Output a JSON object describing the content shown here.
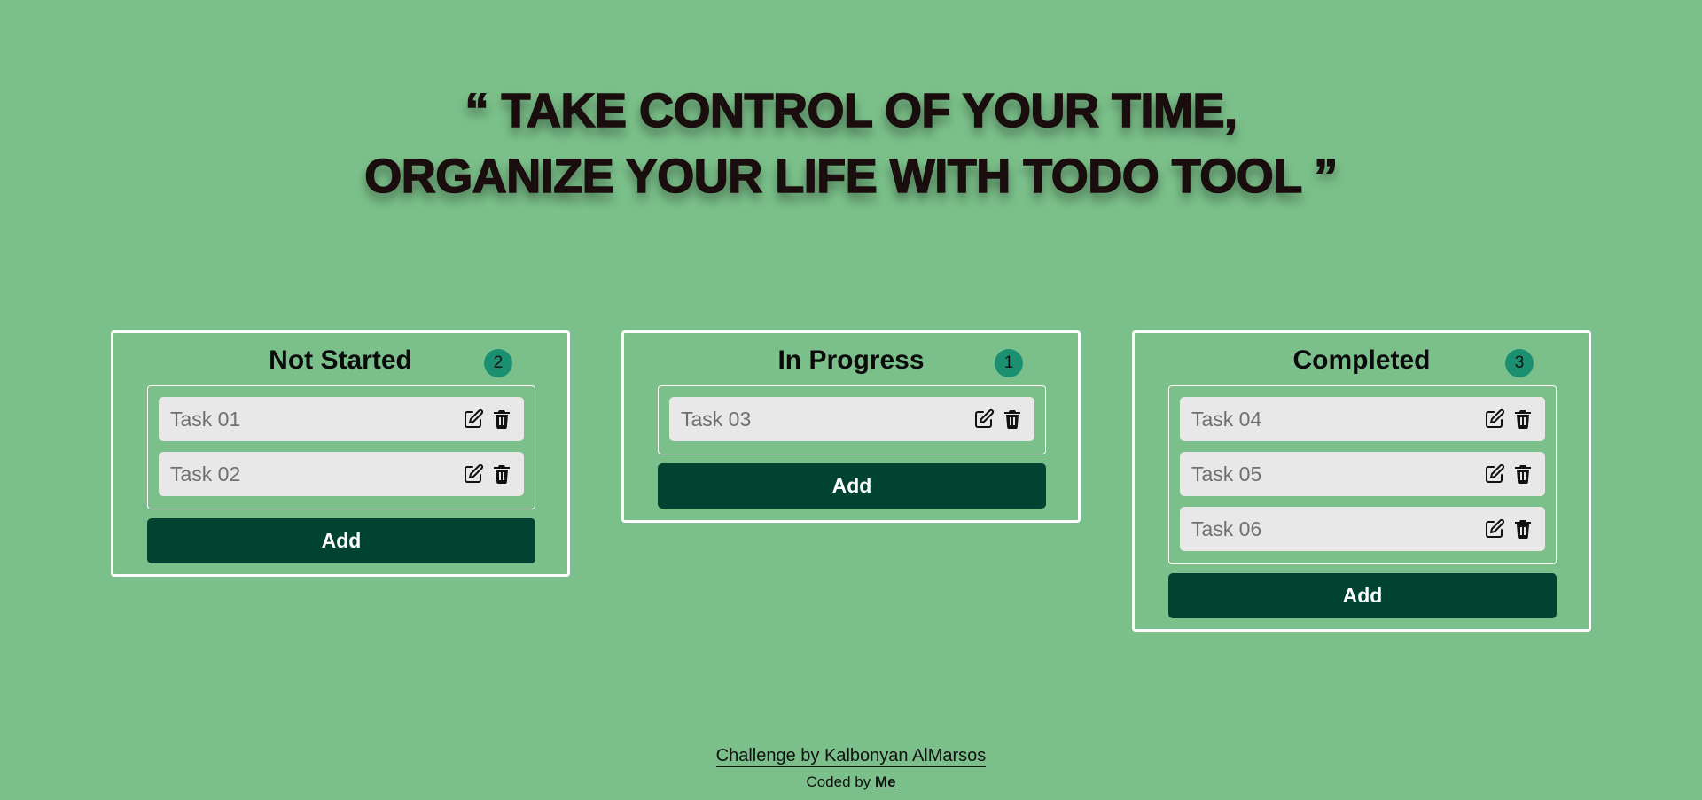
{
  "hero": {
    "line1": "“ TAKE CONTROL OF YOUR TIME,",
    "line2": "ORGANIZE YOUR LIFE WITH TODO TOOL ”"
  },
  "boards": [
    {
      "title": "Not Started",
      "count": "2",
      "tasks": [
        "Task 01",
        "Task 02"
      ],
      "add_label": "Add"
    },
    {
      "title": "In Progress",
      "count": "1",
      "tasks": [
        "Task 03"
      ],
      "add_label": "Add"
    },
    {
      "title": "Completed",
      "count": "3",
      "tasks": [
        "Task 04",
        "Task 05",
        "Task 06"
      ],
      "add_label": "Add"
    }
  ],
  "footer": {
    "credit": "Challenge by Kalbonyan AlMarsos",
    "coded_prefix": "Coded by",
    "coded_link": "Me"
  },
  "colors": {
    "background": "#7bc08a",
    "badge": "#1a9070",
    "add_button": "#004330",
    "task_bg": "#e8e8e8"
  },
  "icons": {
    "edit": "edit-icon",
    "delete": "trash-icon"
  }
}
